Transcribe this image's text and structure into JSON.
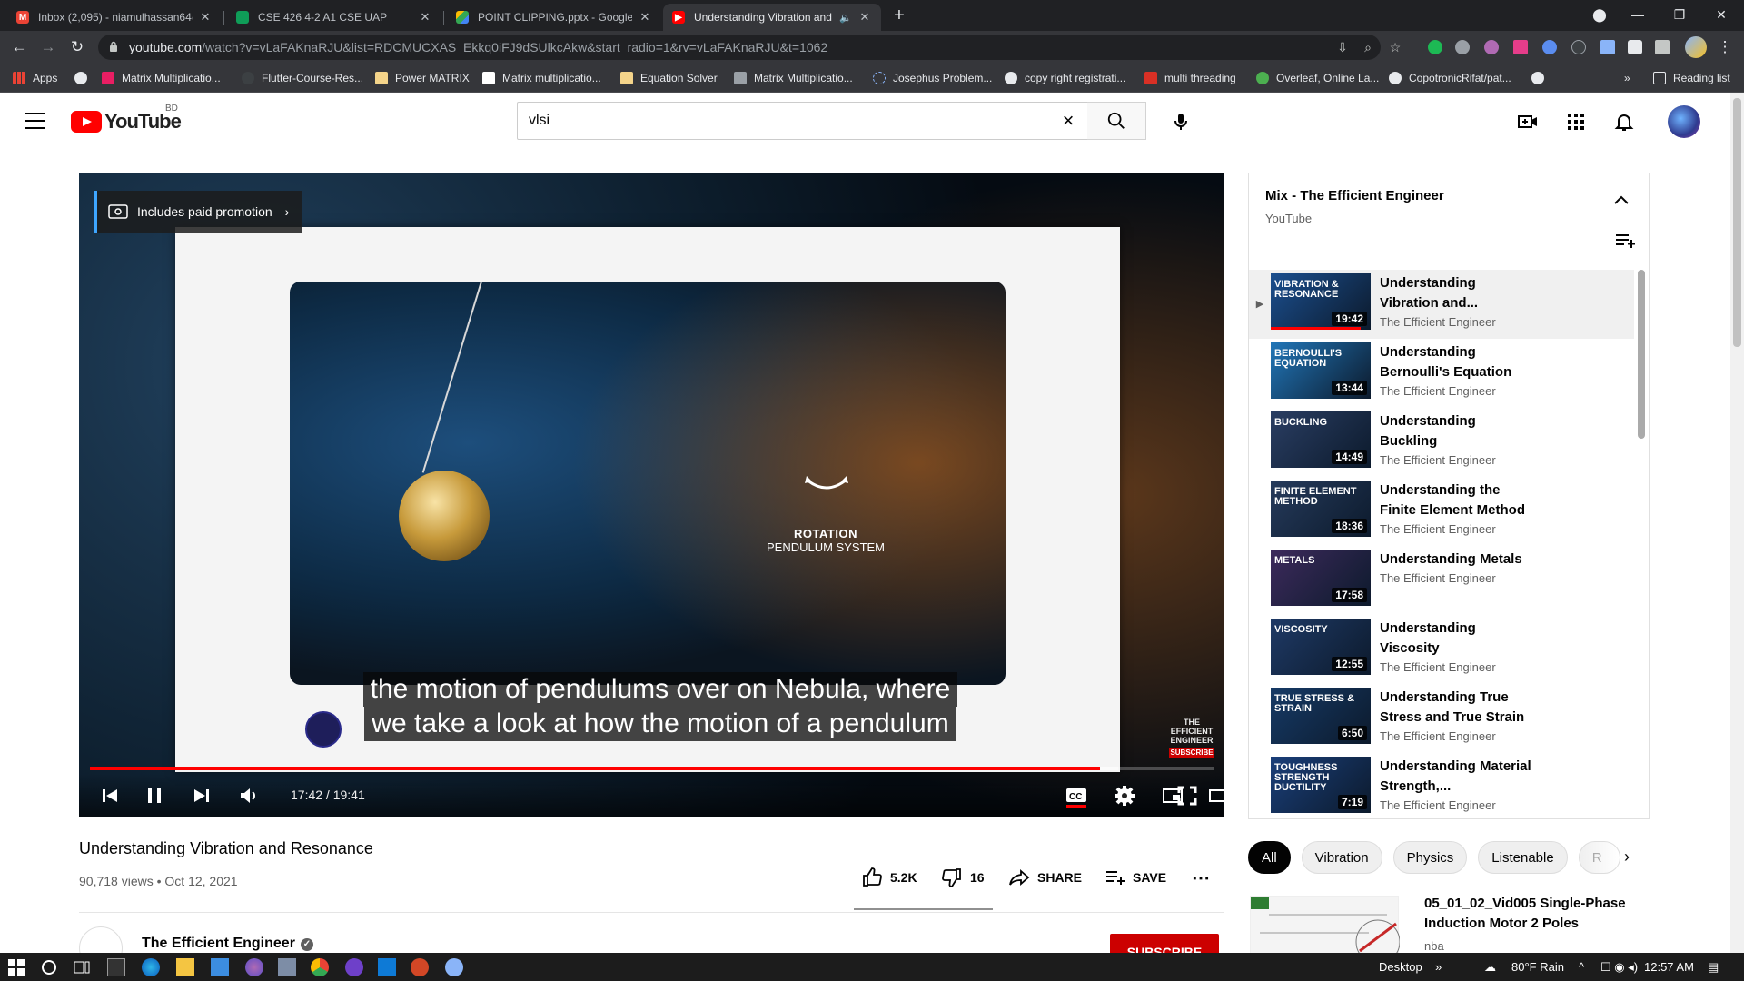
{
  "browser": {
    "tabs": [
      {
        "title": "Inbox (2,095) - niamulhassan64@",
        "favicon": "gmail-icon"
      },
      {
        "title": "CSE 426 4-2 A1 CSE UAP",
        "favicon": "google-sheets-icon"
      },
      {
        "title": "POINT CLIPPING.pptx - Google D",
        "favicon": "google-drive-icon"
      },
      {
        "title": "Understanding Vibration and",
        "favicon": "youtube-icon",
        "active": true
      }
    ],
    "url_host": "youtube.com",
    "url_path": "/watch?v=vLaFAKnaRJU&list=RDCMUCXAS_Ekkq0iFJ9dSUlkcAkw&start_radio=1&rv=vLaFAKnaRJU&t=1062",
    "bookmarks": [
      "Apps",
      "Matrix Multiplicatio...",
      "Flutter-Course-Res...",
      "Power MATRIX",
      "Matrix multiplicatio...",
      "Equation Solver",
      "Matrix Multiplicatio...",
      "Josephus Problem...",
      "copy right registrati...",
      "multi threading",
      "Overleaf, Online La...",
      "CopotronicRifat/pat..."
    ],
    "reading_list": "Reading list"
  },
  "masthead": {
    "logo_text": "YouTube",
    "country": "BD",
    "search_value": "vlsi",
    "search_placeholder": "Search"
  },
  "player": {
    "promo_label": "Includes paid promotion",
    "slide_label_bold": "ROTATION",
    "slide_label": "PENDULUM SYSTEM",
    "caption_line1": "the motion of pendulums over on Nebula, where",
    "caption_line2": "we take a look at how the motion of a pendulum",
    "watermark_brand": "THE EFFICIENT ENGINEER",
    "watermark_subscribe": "SUBSCRIBE",
    "time_current": "17:42",
    "time_total": "19:41",
    "time_display": "17:42 / 19:41",
    "progress_fraction": 0.899,
    "buffered_fraction": 0.915
  },
  "video": {
    "title": "Understanding Vibration and Resonance",
    "meta": "90,718 views • Oct 12, 2021",
    "likes": "5.2K",
    "dislikes": "16",
    "share_label": "SHARE",
    "save_label": "SAVE",
    "channel": "The Efficient Engineer",
    "subscribe_label": "SUBSCRIBE"
  },
  "playlist": {
    "title": "Mix - The Efficient Engineer",
    "subtitle": "YouTube",
    "items": [
      {
        "title": "Understanding Vibration and...",
        "channel": "The Efficient Engineer",
        "duration": "19:42",
        "thumb_text": "Vibration & Resonance",
        "color": "#1b4f8f",
        "current": true
      },
      {
        "title": "Understanding Bernoulli's Equation",
        "channel": "The Efficient Engineer",
        "duration": "13:44",
        "thumb_text": "Bernoulli's Equation",
        "color": "#2176b8"
      },
      {
        "title": "Understanding Buckling",
        "channel": "The Efficient Engineer",
        "duration": "14:49",
        "thumb_text": "Buckling",
        "color": "#2a3e63"
      },
      {
        "title": "Understanding the Finite Element Method",
        "channel": "The Efficient Engineer",
        "duration": "18:36",
        "thumb_text": "Finite Element Method",
        "color": "#263b5c"
      },
      {
        "title": "Understanding Metals",
        "channel": "The Efficient Engineer",
        "duration": "17:58",
        "thumb_text": "Metals",
        "color": "#3d2a5c"
      },
      {
        "title": "Understanding Viscosity",
        "channel": "The Efficient Engineer",
        "duration": "12:55",
        "thumb_text": "Viscosity",
        "color": "#1f3a66"
      },
      {
        "title": "Understanding True Stress and True Strain",
        "channel": "The Efficient Engineer",
        "duration": "6:50",
        "thumb_text": "True Stress & Strain",
        "color": "#163a66"
      },
      {
        "title": "Understanding Material Strength,...",
        "channel": "The Efficient Engineer",
        "duration": "7:19",
        "thumb_text": "Toughness Strength Ductility",
        "color": "#1a3f7a"
      }
    ]
  },
  "chips": [
    "All",
    "Vibration",
    "Physics",
    "Listenable",
    "R"
  ],
  "recommendation": {
    "title": "05_01_02_Vid005 Single-Phase Induction Motor 2 Poles",
    "channel": "nba"
  },
  "taskbar": {
    "desktop_label": "Desktop",
    "weather": "80°F  Rain",
    "clock": "12:57 AM"
  },
  "colors": {
    "youtube_red": "#ff0000",
    "subscribe_red": "#cc0000",
    "chrome_dark": "#35363a"
  }
}
